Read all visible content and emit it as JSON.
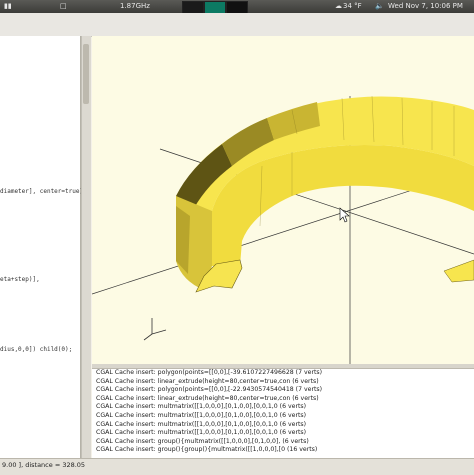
{
  "topbar": {
    "cpu": "1.87GHz",
    "weather": "34 °F",
    "datetime": "Wed Nov 7, 10:06 PM"
  },
  "editor": {
    "lines": [
      "diameter], center=true);",
      "eta+step)],",
      "dius,0,0]) child(0);"
    ]
  },
  "console": {
    "lines": [
      "CGAL Cache insert: polygon(points=[[0,0],[-39.6107227496628 (7 verts)",
      "CGAL Cache insert: linear_extrude(height=80,center=true,con (6 verts)",
      "CGAL Cache insert: polygon(points=[[0,0],[-22.9430574540418 (7 verts)",
      "CGAL Cache insert: linear_extrude(height=80,center=true,con (6 verts)",
      "CGAL Cache insert: multmatrix([[1,0,0,0],[0,1,0,0],[0,0,1,0 (6 verts)",
      "CGAL Cache insert: multmatrix([[1,0,0,0],[0,1,0,0],[0,0,1,0 (6 verts)",
      "CGAL Cache insert: multmatrix([[1,0,0,0],[0,1,0,0],[0,0,1,0 (6 verts)",
      "CGAL Cache insert: multmatrix([[1,0,0,0],[0,1,0,0],[0,0,1,0 (6 verts)",
      "CGAL Cache insert: group(){multmatrix([[1,0,0,0],[0,1,0,0], (6 verts)",
      "CGAL Cache insert: group(){group(){multmatrix([[1,0,0,0],[0 (16 verts)"
    ]
  },
  "statusbar": {
    "text": "9.00 ], distance = 328.05"
  },
  "colors": {
    "viewport_bg": "#fdfbe4",
    "model_light": "#f5e24a",
    "model_dark": "#5e5414",
    "axis": "#333333"
  },
  "icons": {
    "axes_gizmo": "xyz-axes-icon",
    "cursor": "mouse-pointer-icon"
  }
}
